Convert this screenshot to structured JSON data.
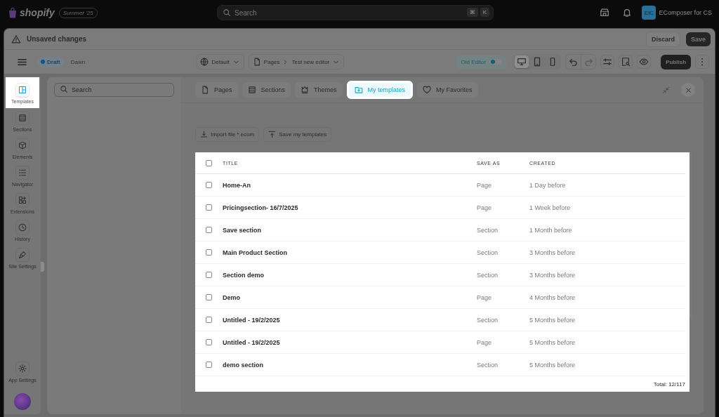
{
  "top_bar": {
    "brand": "shopify",
    "edition": "Summer '25",
    "search": {
      "placeholder": "Search"
    },
    "shortcut_keys": [
      "⌘",
      "K"
    ],
    "store": {
      "initials": "EfC",
      "name": "EComposer for CS"
    }
  },
  "notice_bar": {
    "message": "Unsaved changes",
    "buttons": [
      {
        "label": "Discard",
        "kind": "secondary"
      },
      {
        "label": "Save",
        "kind": "primary"
      }
    ]
  },
  "toolbar": {
    "status": "Draft",
    "theme": "Dawn",
    "locale": "Default",
    "page_type": "Pages",
    "page": "Test new editor",
    "old_editor": {
      "label": "Old Editor",
      "on": true
    },
    "devices": [
      {
        "kind": "desktop",
        "selected": true
      },
      {
        "kind": "tablet",
        "selected": false
      },
      {
        "kind": "mobile",
        "selected": false
      }
    ],
    "publish": "Publish"
  },
  "sidebar": {
    "items": [
      {
        "label": "Templates",
        "selected": true
      },
      {
        "label": "Sections",
        "selected": false
      },
      {
        "label": "Elements",
        "selected": false
      },
      {
        "label": "Navigator",
        "selected": false
      },
      {
        "label": "Extensions",
        "selected": false
      },
      {
        "label": "History",
        "selected": false
      },
      {
        "label": "Site Settings",
        "selected": false
      }
    ],
    "bottom_item": {
      "label": "App Settings"
    }
  },
  "modal": {
    "search": {
      "placeholder": "Search"
    },
    "tabs": [
      {
        "label": "Pages",
        "selected": false
      },
      {
        "label": "Sections",
        "selected": false
      },
      {
        "label": "Themes",
        "selected": false
      },
      {
        "label": "My templates",
        "selected": true
      },
      {
        "label": "My Favorites",
        "selected": false
      }
    ],
    "actions": [
      {
        "label": "Import file *.ecom"
      },
      {
        "label": "Save my templates"
      }
    ],
    "table": {
      "select_all": {
        "checked": false
      },
      "columns": [
        "TITLE",
        "SAVE AS",
        "CREATED"
      ],
      "rows": [
        {
          "title": "Home-An",
          "save_as": "Page",
          "created": "1 Day before",
          "checked": false
        },
        {
          "title": "Pricingsection- 16/7/2025",
          "save_as": "Page",
          "created": "1 Week before",
          "checked": false
        },
        {
          "title": "Save section",
          "save_as": "Section",
          "created": "1 Month before",
          "checked": false
        },
        {
          "title": "Main Product Section",
          "save_as": "Section",
          "created": "3 Months before",
          "checked": false
        },
        {
          "title": "Section demo",
          "save_as": "Section",
          "created": "3 Months before",
          "checked": false
        },
        {
          "title": "Demo",
          "save_as": "Page",
          "created": "4 Months before",
          "checked": false
        },
        {
          "title": "Untitled - 19/2/2025",
          "save_as": "Section",
          "created": "5 Months before",
          "checked": false
        },
        {
          "title": "Untitled - 19/2/2025",
          "save_as": "Page",
          "created": "5 Months before",
          "checked": false
        },
        {
          "title": "demo section",
          "save_as": "Section",
          "created": "5 Months before",
          "checked": false
        }
      ],
      "total": "Total: 12/117"
    }
  }
}
